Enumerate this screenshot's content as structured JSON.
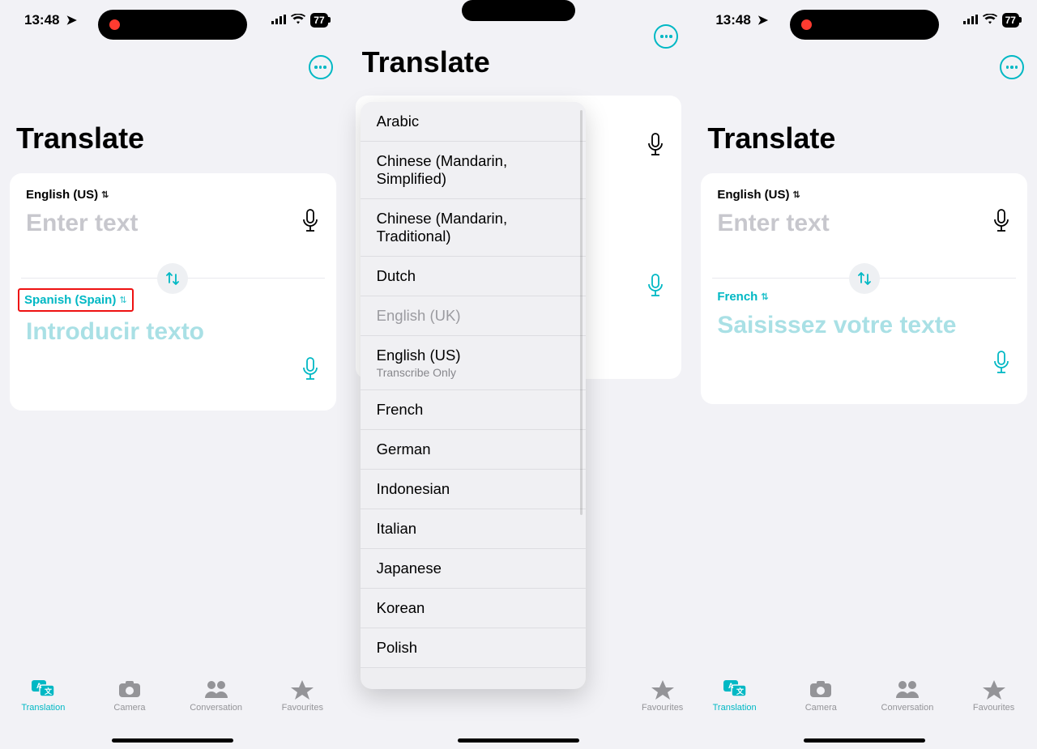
{
  "status": {
    "time": "13:48",
    "battery": "77"
  },
  "screen1": {
    "title": "Translate",
    "source_lang": "English (US)",
    "source_placeholder": "Enter text",
    "target_lang": "Spanish (Spain)",
    "target_placeholder": "Introducir texto"
  },
  "screen2": {
    "title": "Translate",
    "languages": [
      {
        "label": "Arabic"
      },
      {
        "label": "Chinese (Mandarin, Simplified)"
      },
      {
        "label": "Chinese (Mandarin, Traditional)"
      },
      {
        "label": "Dutch"
      },
      {
        "label": "English (UK)",
        "disabled": true
      },
      {
        "label": "English (US)",
        "sub": "Transcribe Only"
      },
      {
        "label": "French"
      },
      {
        "label": "German"
      },
      {
        "label": "Indonesian"
      },
      {
        "label": "Italian"
      },
      {
        "label": "Japanese"
      },
      {
        "label": "Korean"
      },
      {
        "label": "Polish"
      }
    ],
    "tab_fav": "Favourites"
  },
  "screen3": {
    "title": "Translate",
    "source_lang": "English (US)",
    "source_placeholder": "Enter text",
    "target_lang": "French",
    "target_placeholder": "Saisissez votre texte"
  },
  "tabs": {
    "translation": "Translation",
    "camera": "Camera",
    "conversation": "Conversation",
    "favourites": "Favourites"
  }
}
